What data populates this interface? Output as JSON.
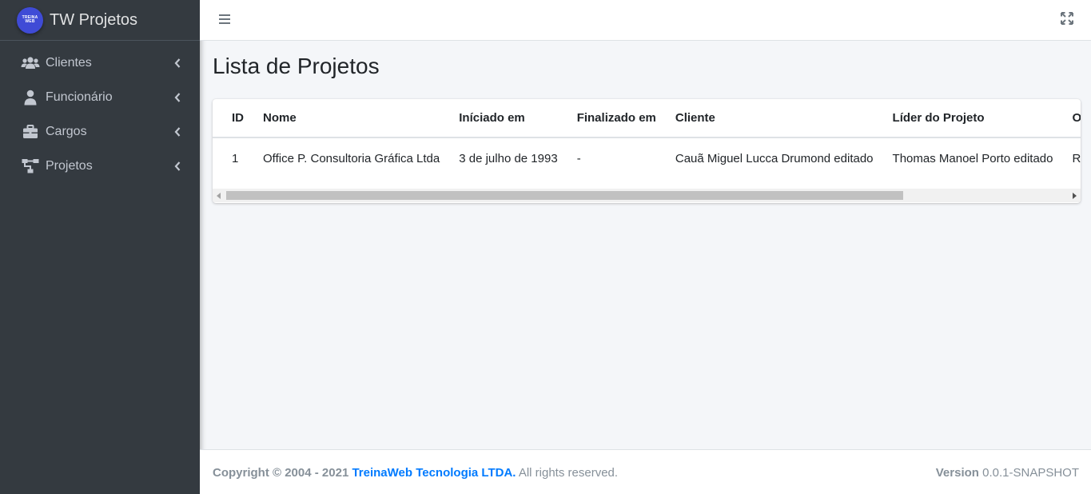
{
  "brand": {
    "logo_text": "TREINA WEB",
    "title": "TW Projetos"
  },
  "sidebar": {
    "items": [
      {
        "label": "Clientes",
        "icon": "users-icon"
      },
      {
        "label": "Funcionário",
        "icon": "user-icon"
      },
      {
        "label": "Cargos",
        "icon": "briefcase-icon"
      },
      {
        "label": "Projetos",
        "icon": "sitemap-icon"
      }
    ]
  },
  "page": {
    "title": "Lista de Projetos"
  },
  "table": {
    "headers": [
      "ID",
      "Nome",
      "Iníciado em",
      "Finalizado em",
      "Cliente",
      "Líder do Projeto",
      "Orçamento"
    ],
    "rows": [
      [
        "1",
        "Office P. Consultoria Gráfica Ltda",
        "3 de julho de 1993",
        "-",
        "Cauã Miguel Lucca Drumond editado",
        "Thomas Manoel Porto editado",
        "R$"
      ]
    ]
  },
  "footer": {
    "copyright_prefix": "Copyright © 2004 - 2021",
    "company_link": "TreinaWeb Tecnologia LTDA.",
    "rights": "All rights reserved.",
    "version_label": "Version",
    "version_value": "0.0.1-SNAPSHOT"
  },
  "colors": {
    "sidebar_bg": "#343a40",
    "link": "#007bff",
    "logo_bg": "#3f4bd6"
  }
}
